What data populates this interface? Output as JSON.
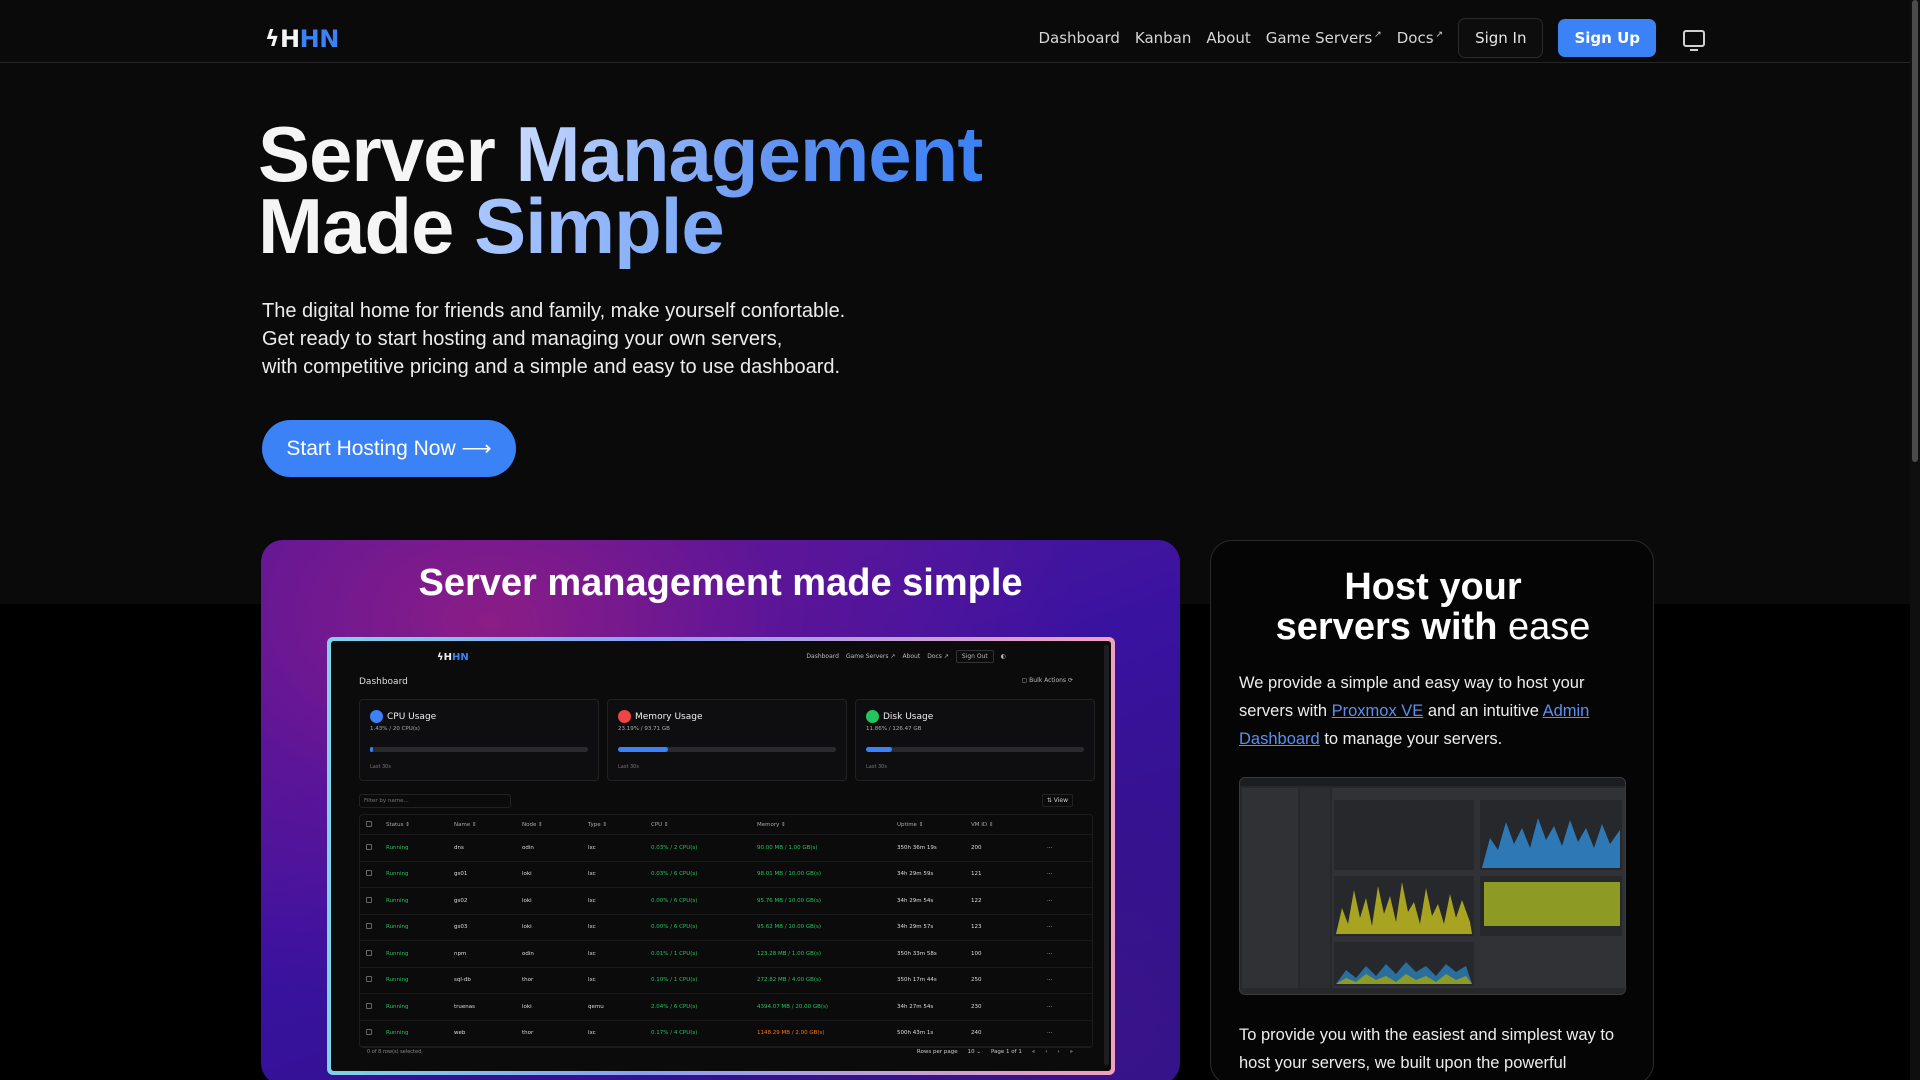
{
  "brand": {
    "bolt": "ϟ",
    "first": "H",
    "rest": "HN"
  },
  "nav": {
    "dashboard": "Dashboard",
    "kanban": "Kanban",
    "about": "About",
    "game_servers": "Game Servers",
    "docs": "Docs",
    "external_mark": "↗",
    "sign_in": "Sign In",
    "sign_up": "Sign Up"
  },
  "hero": {
    "title_1a": "Server ",
    "title_1b": "Management",
    "title_2a": "Made ",
    "title_2b": "Simple",
    "sub_1": "The digital home for friends and family, make yourself confortable.",
    "sub_2": "Get ready to start hosting and managing your own servers,",
    "sub_3": "with competitive pricing and a simple and easy to use dashboard.",
    "cta": "Start Hosting Now ⟶"
  },
  "feature_left": {
    "title": "Server management made simple",
    "screenshot": {
      "logo_first": "ϟH",
      "logo_rest": "HN",
      "nav": [
        "Dashboard",
        "Game Servers ↗",
        "About",
        "Docs ↗"
      ],
      "sign_out": "Sign Out",
      "page_title": "Dashboard",
      "bulk_actions": "▢ Bulk Actions",
      "cards": [
        {
          "title": "CPU Usage",
          "value": "1.43% / 20 CPU(s)",
          "fill": 0.015,
          "color": "#3b82f6",
          "note": "Last 30s"
        },
        {
          "title": "Memory Usage",
          "value": "23.19% / 93.71 GB",
          "fill": 0.23,
          "color": "#ef4444",
          "note": "Last 30s"
        },
        {
          "title": "Disk Usage",
          "value": "11.86% / 126.47 GB",
          "fill": 0.12,
          "color": "#22c55e",
          "note": "Last 30s"
        }
      ],
      "filter_placeholder": "Filter by name...",
      "view": "⇅ View",
      "headers": [
        "Status ⇕",
        "Name ⇕",
        "Node ⇕",
        "Type ⇕",
        "CPU ⇕",
        "Memory ⇕",
        "Uptime ⇕",
        "VM ID ⇕"
      ],
      "rows": [
        [
          "Running",
          "dns",
          "odin",
          "lxc",
          "0.03% / 2 CPU(s)",
          "90.00 MB / 1.00 GB(s)",
          "350h 36m 19s",
          "200"
        ],
        [
          "Running",
          "gs01",
          "loki",
          "lxc",
          "0.03% / 6 CPU(s)",
          "98.01 MB / 10.00 GB(s)",
          "34h 29m 59s",
          "121"
        ],
        [
          "Running",
          "gs02",
          "loki",
          "lxc",
          "0.00% / 6 CPU(s)",
          "95.76 MB / 10.00 GB(s)",
          "34h 29m 54s",
          "122"
        ],
        [
          "Running",
          "gs03",
          "loki",
          "lxc",
          "0.00% / 6 CPU(s)",
          "95.62 MB / 10.00 GB(s)",
          "34h 29m 57s",
          "123"
        ],
        [
          "Running",
          "npm",
          "odin",
          "lxc",
          "0.01% / 1 CPU(s)",
          "123.28 MB / 1.00 GB(s)",
          "350h 33m 58s",
          "100"
        ],
        [
          "Running",
          "sql-db",
          "thor",
          "lxc",
          "0.10% / 1 CPU(s)",
          "272.82 MB / 4.00 GB(s)",
          "350h 17m 44s",
          "250"
        ],
        [
          "Running",
          "truenas",
          "loki",
          "qemu",
          "2.04% / 6 CPU(s)",
          "4394.07 MB / 20.00 GB(s)",
          "34h 27m 54s",
          "230"
        ],
        [
          "Running",
          "web",
          "thor",
          "lxc",
          "0.17% / 4 CPU(s)",
          "1148.29 MB / 2.00 GB(s)",
          "500h 43m 1s",
          "240"
        ]
      ],
      "row_menu": "···",
      "selected": "0 of 8 row(s) selected.",
      "rows_per_page": "Rows per page",
      "rows_per_page_value": "10 ⌄",
      "page": "Page 1 of 1",
      "pager_icons": [
        "«",
        "‹",
        "›",
        "»"
      ]
    }
  },
  "feature_right": {
    "title_1": "Host your",
    "title_2a": "servers with ",
    "title_2b": "ease",
    "text_1": "We provide a simple and easy way to host your servers with ",
    "link_1": "Proxmox VE",
    "text_2": " and an intuitive ",
    "link_2": "Admin Dashboard",
    "text_3": " to manage your servers.",
    "text_bottom": "To provide you with the easiest and simplest way to host your servers, we built upon the powerful"
  }
}
